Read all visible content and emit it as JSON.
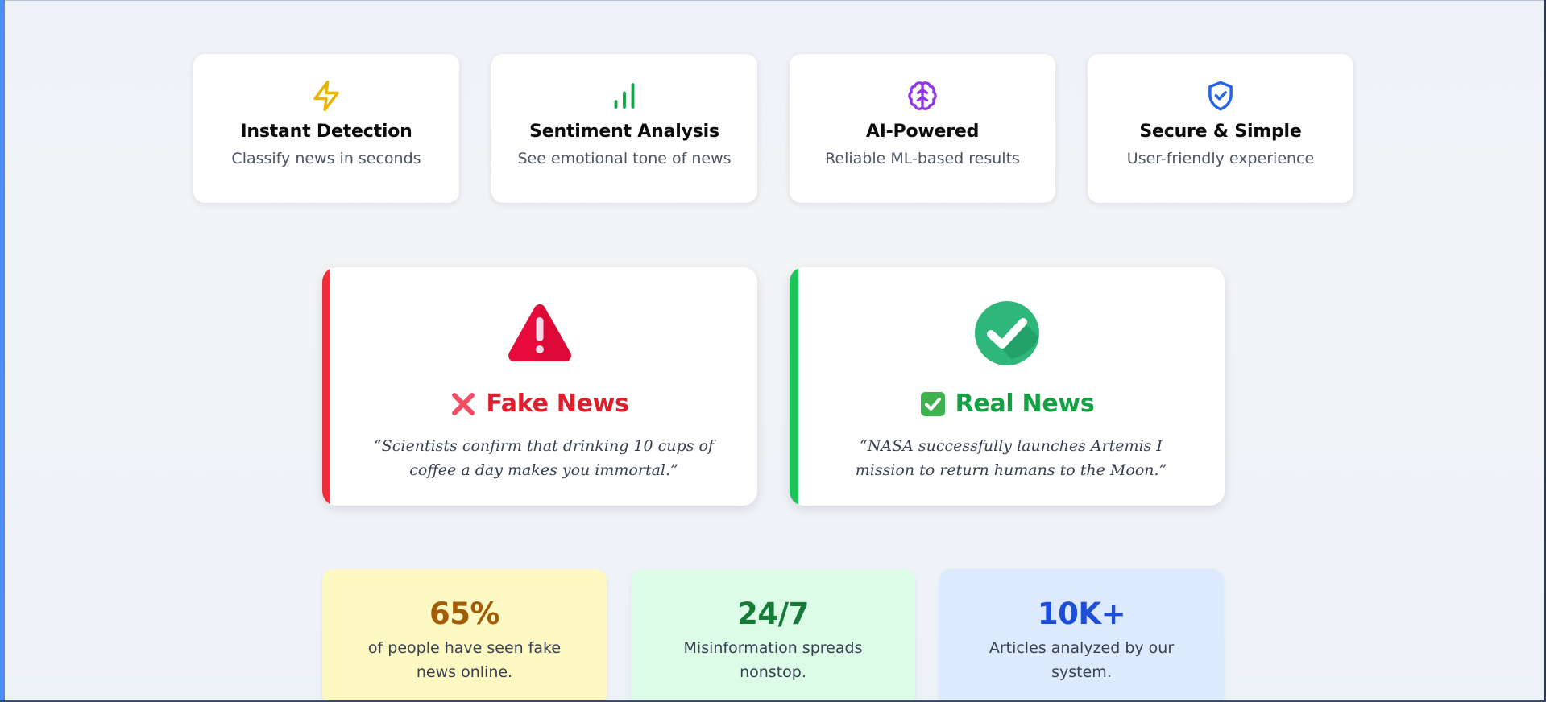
{
  "features": [
    {
      "title": "Instant Detection",
      "desc": "Classify news in seconds",
      "icon": "lightning-icon",
      "color": "#eab308"
    },
    {
      "title": "Sentiment Analysis",
      "desc": "See emotional tone of news",
      "icon": "bar-chart-icon",
      "color": "#16a34a"
    },
    {
      "title": "AI-Powered",
      "desc": "Reliable ML-based results",
      "icon": "brain-icon",
      "color": "#9333ea"
    },
    {
      "title": "Secure & Simple",
      "desc": "User-friendly experience",
      "icon": "shield-check-icon",
      "color": "#2563eb"
    }
  ],
  "examples": {
    "fake": {
      "title": "Fake News",
      "quote": "“Scientists confirm that drinking 10 cups of coffee a day makes you immortal.”",
      "icon": "warning-triangle-icon",
      "accent": "#ef2d3a"
    },
    "real": {
      "title": "Real News",
      "quote": "“NASA successfully launches Artemis I mission to return humans to the Moon.”",
      "icon": "check-circle-icon",
      "accent": "#1cc45a"
    }
  },
  "stats": [
    {
      "value": "65%",
      "label": "of people have seen fake news online.",
      "color": "#a15c07"
    },
    {
      "value": "24/7",
      "label": "Misinformation spreads nonstop.",
      "color": "#157a36"
    },
    {
      "value": "10K+",
      "label": "Articles analyzed by our system.",
      "color": "#1d4ed8"
    }
  ]
}
